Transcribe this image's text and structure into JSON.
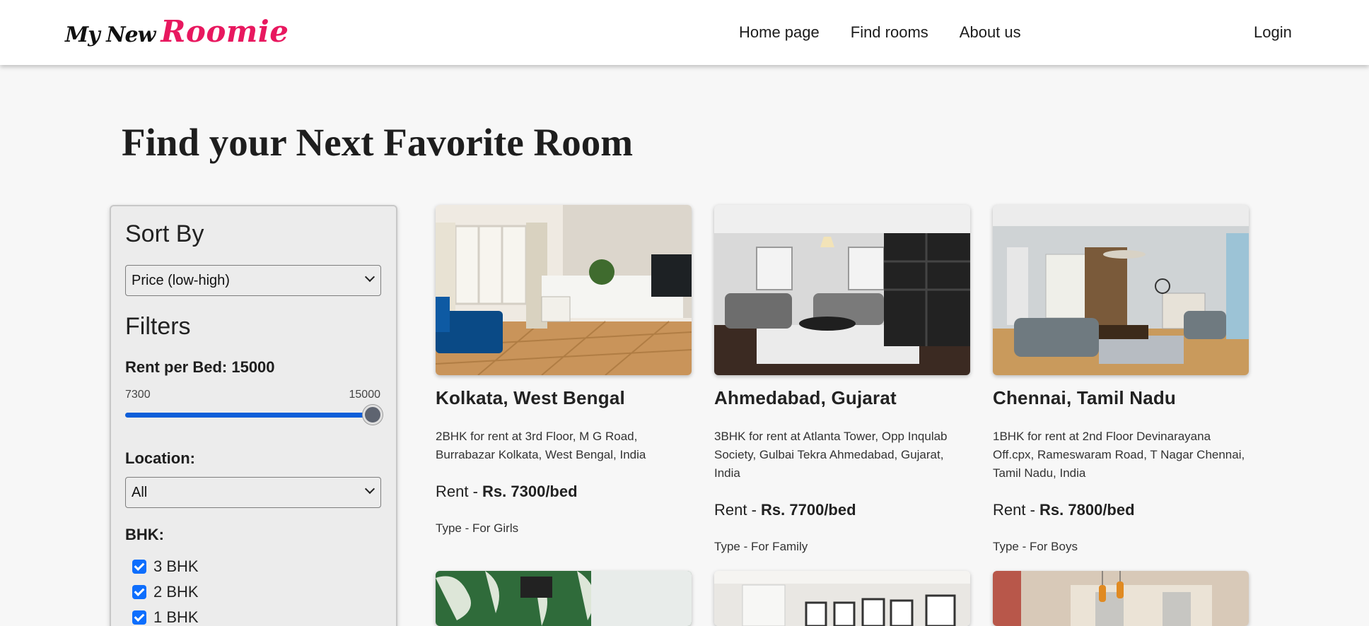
{
  "header": {
    "logo_part1": "My New",
    "logo_part2": "Roomie",
    "nav": [
      "Home page",
      "Find rooms",
      "About us"
    ],
    "login": "Login"
  },
  "page_title": "Find your Next Favorite Room",
  "sidebar": {
    "sort_heading": "Sort By",
    "sort_value": "Price (low-high)",
    "filters_heading": "Filters",
    "rent_label": "Rent per Bed: 15000",
    "range_min": "7300",
    "range_max": "15000",
    "slider_level_percent": 100,
    "location_label": "Location:",
    "location_value": "All",
    "bhk_label": "BHK:",
    "bhk_options": [
      {
        "label": "3 BHK",
        "checked": true
      },
      {
        "label": "2 BHK",
        "checked": true
      },
      {
        "label": "1 BHK",
        "checked": true
      }
    ]
  },
  "rooms": [
    {
      "title": "Kolkata, West Bengal",
      "description": "2BHK for rent at 3rd Floor, M G Road, Burrabazar Kolkata, West Bengal, India",
      "rent_prefix": "Rent - ",
      "rent_value": "Rs. 7300/bed",
      "type": "Type - For Girls"
    },
    {
      "title": "Ahmedabad, Gujarat",
      "description": "3BHK for rent at Atlanta Tower, Opp Inqulab Society, Gulbai Tekra Ahmedabad, Gujarat, India",
      "rent_prefix": "Rent - ",
      "rent_value": "Rs. 7700/bed",
      "type": "Type - For Family"
    },
    {
      "title": "Chennai, Tamil Nadu",
      "description": "1BHK for rent at 2nd Floor Devinarayana Off.cpx, Rameswaram Road, T Nagar Chennai, Tamil Nadu, India",
      "rent_prefix": "Rent - ",
      "rent_value": "Rs. 7800/bed",
      "type": "Type - For Boys"
    }
  ]
}
